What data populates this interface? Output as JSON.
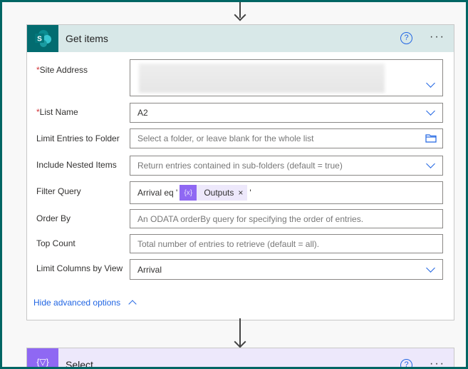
{
  "get_items": {
    "title": "Get items",
    "logo_letter": "S",
    "help": "?",
    "more": "···",
    "fields": {
      "site_address": {
        "label": "Site Address",
        "required": "*"
      },
      "list_name": {
        "label": "List Name",
        "required": "*",
        "value": "A2"
      },
      "limit_folder": {
        "label": "Limit Entries to Folder",
        "placeholder": "Select a folder, or leave blank for the whole list"
      },
      "nested": {
        "label": "Include Nested Items",
        "placeholder": "Return entries contained in sub-folders (default = true)"
      },
      "filter": {
        "label": "Filter Query",
        "prefix": "Arrival eq '",
        "token_icon": "{x}",
        "token": "Outputs",
        "token_close": "×",
        "suffix": "'"
      },
      "order_by": {
        "label": "Order By",
        "placeholder": "An ODATA orderBy query for specifying the order of entries."
      },
      "top_count": {
        "label": "Top Count",
        "placeholder": "Total number of entries to retrieve (default = all)."
      },
      "limit_columns": {
        "label": "Limit Columns by View",
        "value": "Arrival"
      }
    },
    "hide_advanced": "Hide advanced options"
  },
  "select": {
    "title": "Select",
    "logo": "{▽}",
    "help": "?",
    "more": "···"
  },
  "colors": {
    "frame": "#006664",
    "sharepoint": "#036c70",
    "select": "#8f68f3",
    "link": "#2266e3"
  }
}
